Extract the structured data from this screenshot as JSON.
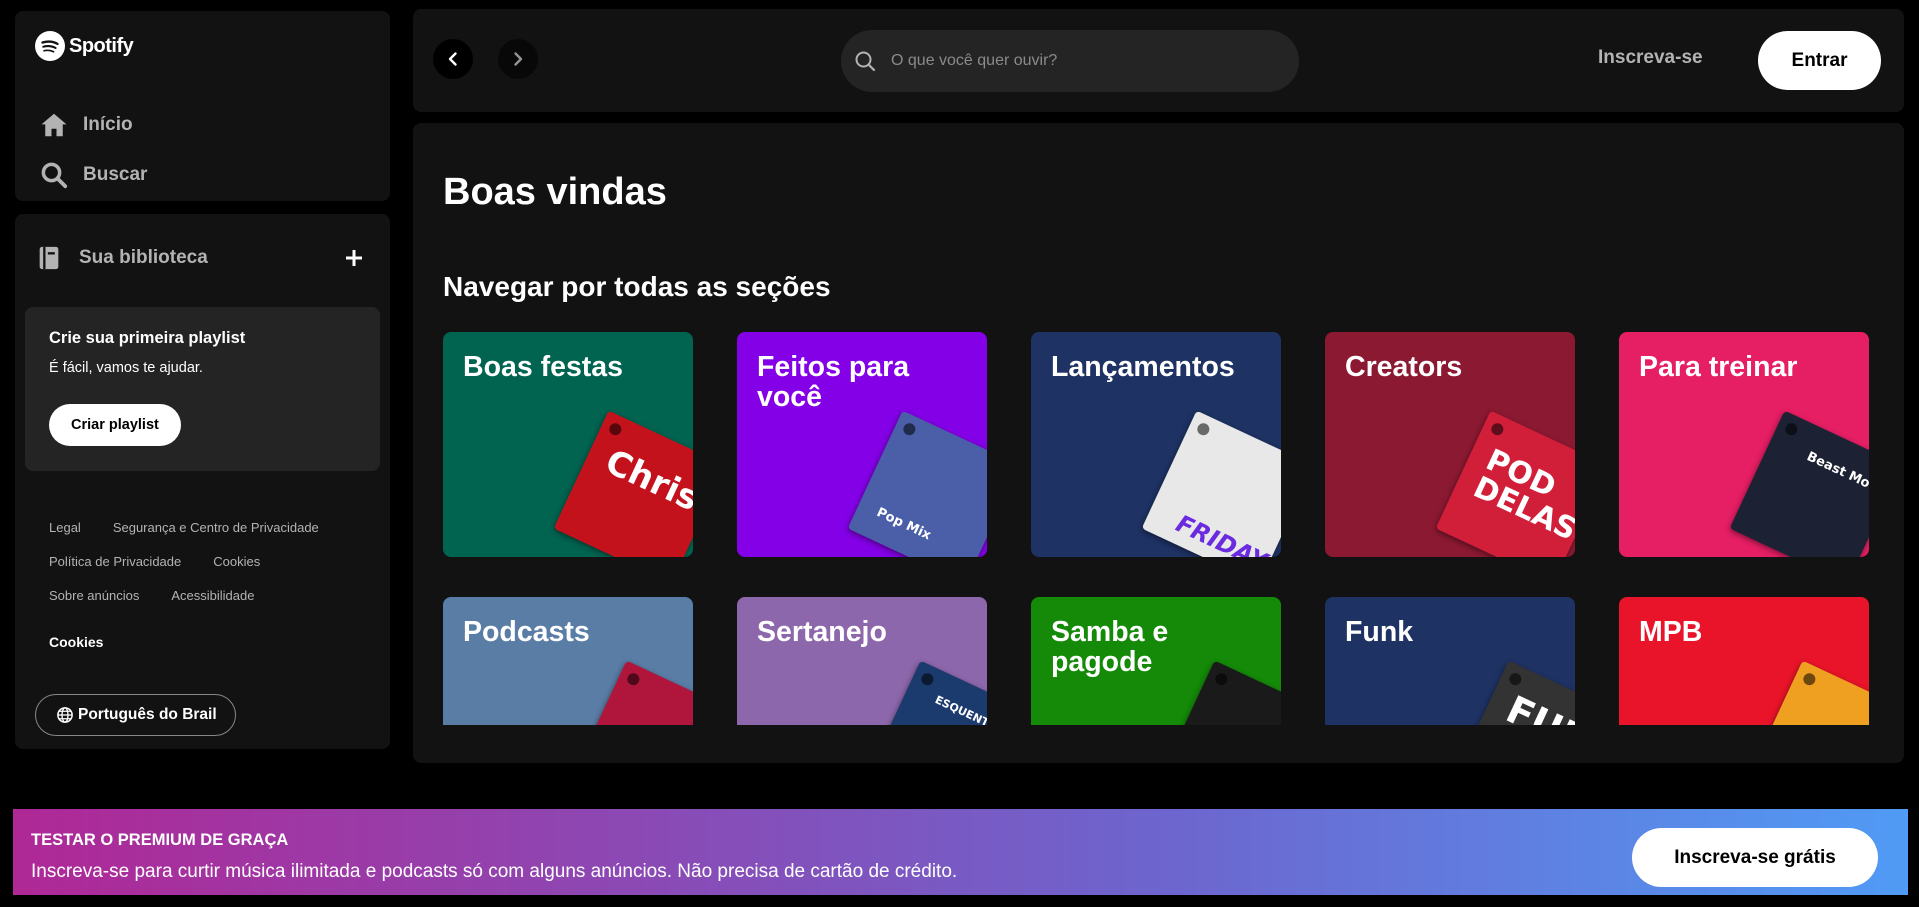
{
  "brand": {
    "name": "Spotify"
  },
  "nav": {
    "home_label": "Início",
    "search_label": "Buscar"
  },
  "library": {
    "title": "Sua biblioteca",
    "create_card": {
      "title": "Crie sua primeira playlist",
      "subtitle": "É fácil, vamos te ajudar.",
      "button": "Criar playlist"
    },
    "footer_links": [
      [
        "Legal",
        "Segurança e Centro de Privacidade"
      ],
      [
        "Política de Privacidade",
        "Cookies"
      ],
      [
        "Sobre anúncios",
        "Acessibilidade"
      ]
    ],
    "cookies_label": "Cookies",
    "language_button": "Português do Brail"
  },
  "topbar": {
    "search_placeholder": "O que você quer ouvir?",
    "signup_label": "Inscreva-se",
    "login_label": "Entrar"
  },
  "main": {
    "title": "Boas vindas",
    "section_title": "Navegar por todas as seções",
    "cards": [
      {
        "label": "Boas festas",
        "color": "#006450",
        "art_color": "#c4121c",
        "art_text": "Christm Hi"
      },
      {
        "label": "Feitos para você",
        "color": "#8400e7",
        "art_color": "#4a5fa8",
        "art_text": "Pop Mix"
      },
      {
        "label": "Lançamentos",
        "color": "#1e3264",
        "art_color": "#e8e8e8",
        "art_text": "FRIDAY"
      },
      {
        "label": "Creators",
        "color": "#8c1932",
        "art_color": "#d11f3a",
        "art_text": "POD DELAS"
      },
      {
        "label": "Para treinar",
        "color": "#e61e64",
        "art_color": "#1c2233",
        "art_text": "Beast Mode"
      },
      {
        "label": "Podcasts",
        "color": "#5a7da6",
        "art_color": "#b0163c",
        "art_text": ""
      },
      {
        "label": "Sertanejo",
        "color": "#8d67ab",
        "art_color": "#1b3a6e",
        "art_text": "ESQUENTA"
      },
      {
        "label": "Samba e pagode",
        "color": "#148a08",
        "art_color": "#1a1a1a",
        "art_text": ""
      },
      {
        "label": "Funk",
        "color": "#1e3264",
        "art_color": "#333333",
        "art_text": "FUN"
      },
      {
        "label": "MPB",
        "color": "#e91429",
        "art_color": "#f0a020",
        "art_text": ""
      }
    ]
  },
  "banner": {
    "title": "TESTAR O PREMIUM DE GRAÇA",
    "text": "Inscreva-se para curtir música ilimitada e podcasts só com alguns anúncios. Não precisa de cartão de crédito.",
    "button": "Inscreva-se grátis"
  }
}
